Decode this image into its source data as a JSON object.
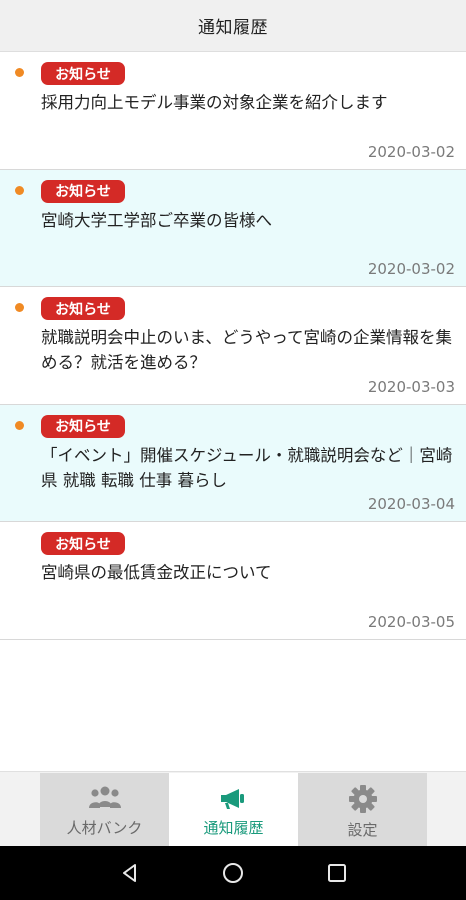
{
  "header": {
    "title": "通知履歴"
  },
  "notifications": [
    {
      "badge": "お知らせ",
      "title": "採用力向上モデル事業の対象企業を紹介します",
      "date": "2020-03-02",
      "unread": true,
      "highlighted": false
    },
    {
      "badge": "お知らせ",
      "title": "宮崎大学工学部ご卒業の皆様へ",
      "date": "2020-03-02",
      "unread": true,
      "highlighted": true
    },
    {
      "badge": "お知らせ",
      "title": "就職説明会中止のいま、どうやって宮崎の企業情報を集める？就活を進める？",
      "date": "2020-03-03",
      "unread": true,
      "highlighted": false
    },
    {
      "badge": "お知らせ",
      "title": "「イベント」開催スケジュール・就職説明会など｜宮崎県 就職 転職 仕事 暮らし",
      "date": "2020-03-04",
      "unread": true,
      "highlighted": true
    },
    {
      "badge": "お知らせ",
      "title": "宮崎県の最低賃金改正について",
      "date": "2020-03-05",
      "unread": false,
      "highlighted": false
    }
  ],
  "bottom_nav": {
    "tabs": [
      {
        "label": "人材バンク",
        "icon": "people-icon",
        "active": false
      },
      {
        "label": "通知履歴",
        "icon": "megaphone-icon",
        "active": true
      },
      {
        "label": "設定",
        "icon": "gear-icon",
        "active": false
      }
    ]
  },
  "system_nav": {
    "buttons": [
      "back-icon",
      "home-icon",
      "recents-icon"
    ]
  },
  "colors": {
    "badge": "#d42a26",
    "unread_dot": "#f08a24",
    "highlight_bg": "#eafbfc",
    "active_tab_text": "#1a9a7c"
  }
}
